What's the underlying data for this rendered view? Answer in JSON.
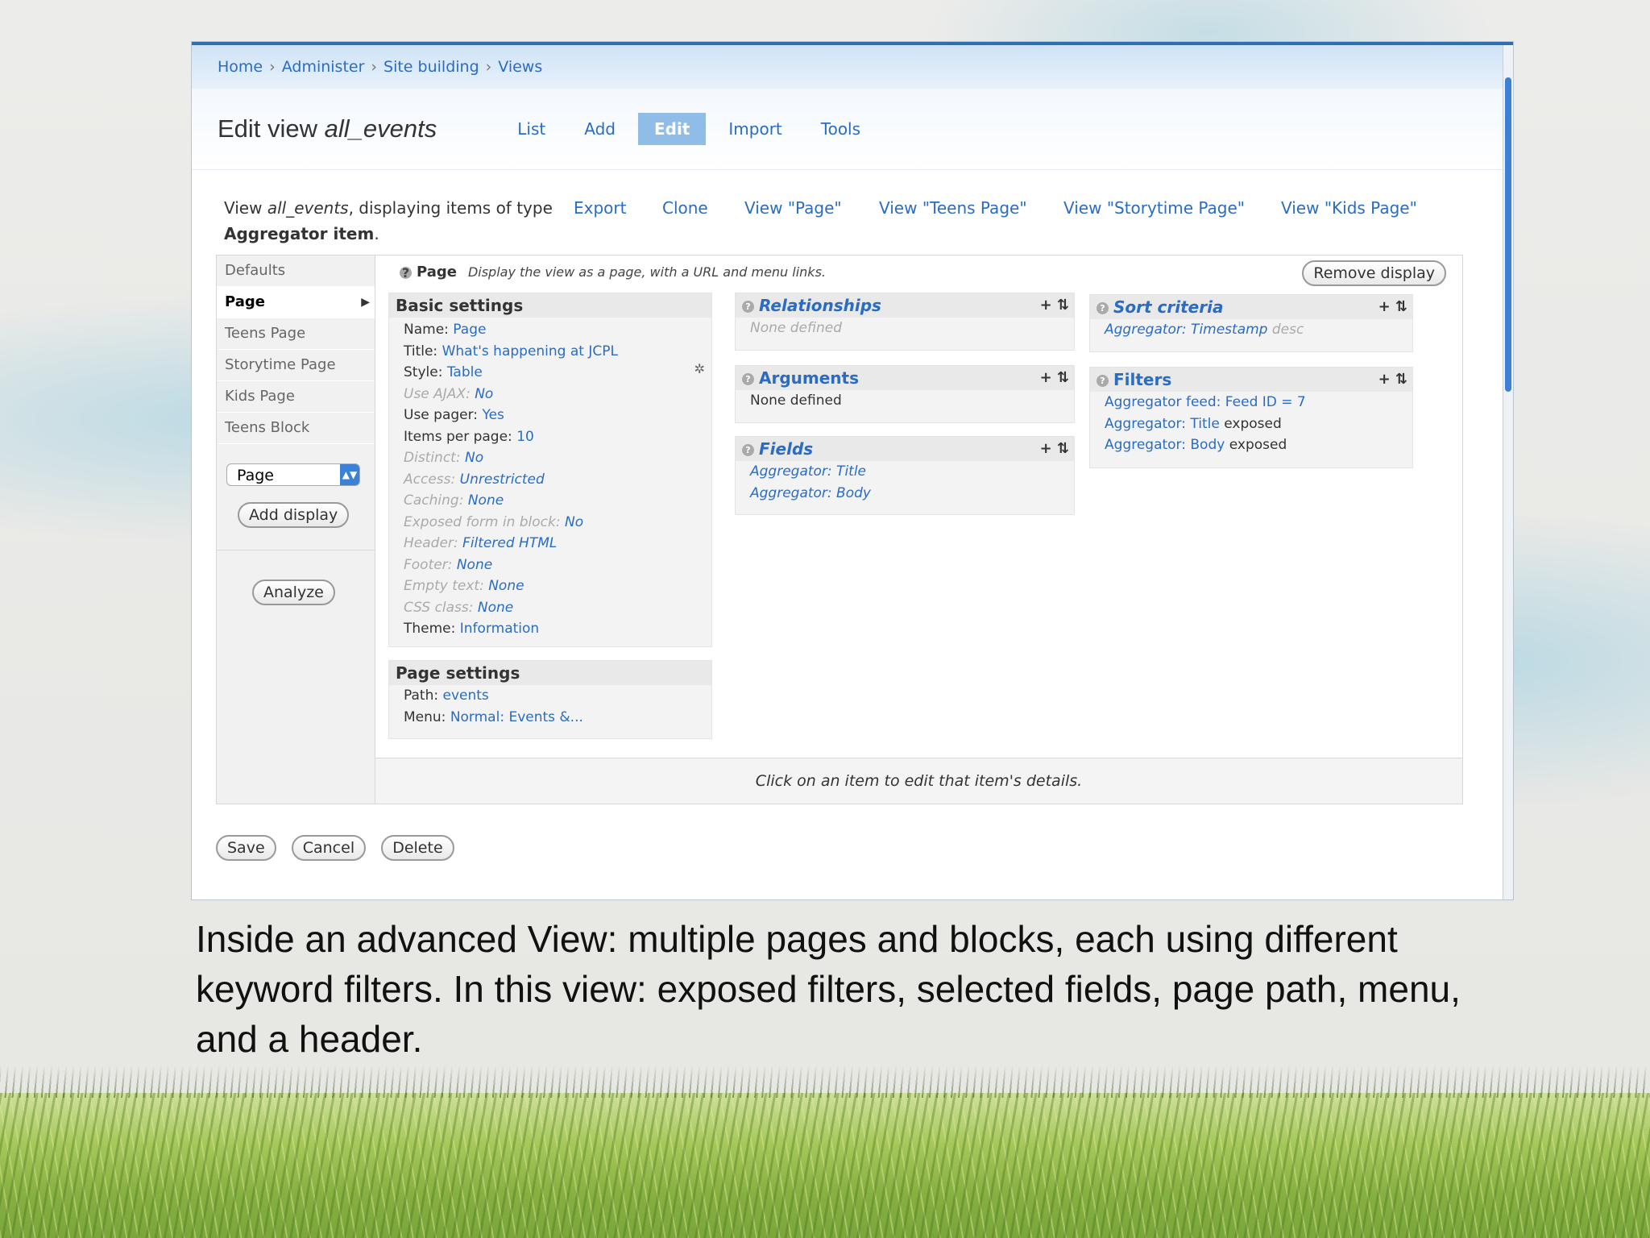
{
  "breadcrumb": [
    "Home",
    "Administer",
    "Site building",
    "Views"
  ],
  "title": {
    "prefix": "Edit view",
    "name": "all_events"
  },
  "tabs": [
    "List",
    "Add",
    "Edit",
    "Import",
    "Tools"
  ],
  "active_tab": "Edit",
  "info": {
    "pre": "View",
    "name": "all_events",
    "post": ", displaying items of type",
    "type": "Aggregator item",
    "tail": "."
  },
  "actions": [
    "Export",
    "Clone",
    "View \"Page\"",
    "View \"Teens Page\"",
    "View \"Storytime Page\"",
    "View \"Kids Page\""
  ],
  "displays": [
    "Defaults",
    "Page",
    "Teens Page",
    "Storytime Page",
    "Kids Page",
    "Teens Block"
  ],
  "selected_display": "Page",
  "display_select": "Page",
  "add_display": "Add display",
  "analyze": "Analyze",
  "page_header": {
    "label": "Page",
    "desc": "Display the view as a page, with a URL and menu links."
  },
  "remove_display": "Remove display",
  "basic_settings": {
    "title": "Basic settings",
    "rows": [
      {
        "k": "Name:",
        "v": "Page",
        "dim": false
      },
      {
        "k": "Title:",
        "v": "What's happening at JCPL",
        "dim": false
      },
      {
        "k": "Style:",
        "v": "Table",
        "dim": false
      },
      {
        "k": "Use AJAX:",
        "v": "No",
        "dim": true
      },
      {
        "k": "Use pager:",
        "v": "Yes",
        "dim": false
      },
      {
        "k": "Items per page:",
        "v": "10",
        "dim": false
      },
      {
        "k": "Distinct:",
        "v": "No",
        "dim": true
      },
      {
        "k": "Access:",
        "v": "Unrestricted",
        "dim": true
      },
      {
        "k": "Caching:",
        "v": "None",
        "dim": true
      },
      {
        "k": "Exposed form in block:",
        "v": "No",
        "dim": true
      },
      {
        "k": "Header:",
        "v": "Filtered HTML",
        "dim": true
      },
      {
        "k": "Footer:",
        "v": "None",
        "dim": true
      },
      {
        "k": "Empty text:",
        "v": "None",
        "dim": true
      },
      {
        "k": "CSS class:",
        "v": "None",
        "dim": true
      },
      {
        "k": "Theme:",
        "v": "Information",
        "dim": false
      }
    ]
  },
  "page_settings": {
    "title": "Page settings",
    "rows": [
      {
        "k": "Path:",
        "v": "events"
      },
      {
        "k": "Menu:",
        "v": "Normal: Events &..."
      }
    ]
  },
  "relationships": {
    "title": "Relationships",
    "empty": "None defined"
  },
  "arguments": {
    "title": "Arguments",
    "empty": "None defined"
  },
  "fields": {
    "title": "Fields",
    "items": [
      "Aggregator: Title",
      "Aggregator: Body"
    ]
  },
  "sort": {
    "title": "Sort criteria",
    "item": "Aggregator: Timestamp",
    "suffix": "desc"
  },
  "filters": {
    "title": "Filters",
    "rows": [
      {
        "k": "Aggregator feed:",
        "v": "Feed ID = 7",
        "extra": ""
      },
      {
        "k": "Aggregator:",
        "v": "Title",
        "extra": "exposed"
      },
      {
        "k": "Aggregator:",
        "v": "Body",
        "extra": "exposed"
      }
    ]
  },
  "footer_hint": "Click on an item to edit that item's details.",
  "buttons": [
    "Save",
    "Cancel",
    "Delete"
  ],
  "caption": "Inside an advanced View: multiple pages and blocks, each using different keyword filters. In this view: exposed filters, selected fields,  page path, menu, and a header."
}
